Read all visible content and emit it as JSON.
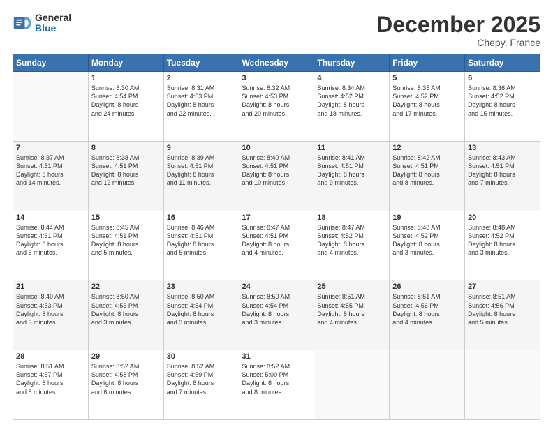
{
  "header": {
    "logo_line1": "General",
    "logo_line2": "Blue",
    "month": "December 2025",
    "location": "Chepy, France"
  },
  "days_of_week": [
    "Sunday",
    "Monday",
    "Tuesday",
    "Wednesday",
    "Thursday",
    "Friday",
    "Saturday"
  ],
  "weeks": [
    [
      {
        "day": "",
        "info": ""
      },
      {
        "day": "1",
        "info": "Sunrise: 8:30 AM\nSunset: 4:54 PM\nDaylight: 8 hours\nand 24 minutes."
      },
      {
        "day": "2",
        "info": "Sunrise: 8:31 AM\nSunset: 4:53 PM\nDaylight: 8 hours\nand 22 minutes."
      },
      {
        "day": "3",
        "info": "Sunrise: 8:32 AM\nSunset: 4:53 PM\nDaylight: 8 hours\nand 20 minutes."
      },
      {
        "day": "4",
        "info": "Sunrise: 8:34 AM\nSunset: 4:52 PM\nDaylight: 8 hours\nand 18 minutes."
      },
      {
        "day": "5",
        "info": "Sunrise: 8:35 AM\nSunset: 4:52 PM\nDaylight: 8 hours\nand 17 minutes."
      },
      {
        "day": "6",
        "info": "Sunrise: 8:36 AM\nSunset: 4:52 PM\nDaylight: 8 hours\nand 15 minutes."
      }
    ],
    [
      {
        "day": "7",
        "info": "Sunrise: 8:37 AM\nSunset: 4:51 PM\nDaylight: 8 hours\nand 14 minutes."
      },
      {
        "day": "8",
        "info": "Sunrise: 8:38 AM\nSunset: 4:51 PM\nDaylight: 8 hours\nand 12 minutes."
      },
      {
        "day": "9",
        "info": "Sunrise: 8:39 AM\nSunset: 4:51 PM\nDaylight: 8 hours\nand 11 minutes."
      },
      {
        "day": "10",
        "info": "Sunrise: 8:40 AM\nSunset: 4:51 PM\nDaylight: 8 hours\nand 10 minutes."
      },
      {
        "day": "11",
        "info": "Sunrise: 8:41 AM\nSunset: 4:51 PM\nDaylight: 8 hours\nand 9 minutes."
      },
      {
        "day": "12",
        "info": "Sunrise: 8:42 AM\nSunset: 4:51 PM\nDaylight: 8 hours\nand 8 minutes."
      },
      {
        "day": "13",
        "info": "Sunrise: 8:43 AM\nSunset: 4:51 PM\nDaylight: 8 hours\nand 7 minutes."
      }
    ],
    [
      {
        "day": "14",
        "info": "Sunrise: 8:44 AM\nSunset: 4:51 PM\nDaylight: 8 hours\nand 6 minutes."
      },
      {
        "day": "15",
        "info": "Sunrise: 8:45 AM\nSunset: 4:51 PM\nDaylight: 8 hours\nand 5 minutes."
      },
      {
        "day": "16",
        "info": "Sunrise: 8:46 AM\nSunset: 4:51 PM\nDaylight: 8 hours\nand 5 minutes."
      },
      {
        "day": "17",
        "info": "Sunrise: 8:47 AM\nSunset: 4:51 PM\nDaylight: 8 hours\nand 4 minutes."
      },
      {
        "day": "18",
        "info": "Sunrise: 8:47 AM\nSunset: 4:52 PM\nDaylight: 8 hours\nand 4 minutes."
      },
      {
        "day": "19",
        "info": "Sunrise: 8:48 AM\nSunset: 4:52 PM\nDaylight: 8 hours\nand 3 minutes."
      },
      {
        "day": "20",
        "info": "Sunrise: 8:48 AM\nSunset: 4:52 PM\nDaylight: 8 hours\nand 3 minutes."
      }
    ],
    [
      {
        "day": "21",
        "info": "Sunrise: 8:49 AM\nSunset: 4:53 PM\nDaylight: 8 hours\nand 3 minutes."
      },
      {
        "day": "22",
        "info": "Sunrise: 8:50 AM\nSunset: 4:53 PM\nDaylight: 8 hours\nand 3 minutes."
      },
      {
        "day": "23",
        "info": "Sunrise: 8:50 AM\nSunset: 4:54 PM\nDaylight: 8 hours\nand 3 minutes."
      },
      {
        "day": "24",
        "info": "Sunrise: 8:50 AM\nSunset: 4:54 PM\nDaylight: 8 hours\nand 3 minutes."
      },
      {
        "day": "25",
        "info": "Sunrise: 8:51 AM\nSunset: 4:55 PM\nDaylight: 8 hours\nand 4 minutes."
      },
      {
        "day": "26",
        "info": "Sunrise: 8:51 AM\nSunset: 4:56 PM\nDaylight: 8 hours\nand 4 minutes."
      },
      {
        "day": "27",
        "info": "Sunrise: 8:51 AM\nSunset: 4:56 PM\nDaylight: 8 hours\nand 5 minutes."
      }
    ],
    [
      {
        "day": "28",
        "info": "Sunrise: 8:51 AM\nSunset: 4:57 PM\nDaylight: 8 hours\nand 5 minutes."
      },
      {
        "day": "29",
        "info": "Sunrise: 8:52 AM\nSunset: 4:58 PM\nDaylight: 8 hours\nand 6 minutes."
      },
      {
        "day": "30",
        "info": "Sunrise: 8:52 AM\nSunset: 4:59 PM\nDaylight: 8 hours\nand 7 minutes."
      },
      {
        "day": "31",
        "info": "Sunrise: 8:52 AM\nSunset: 5:00 PM\nDaylight: 8 hours\nand 8 minutes."
      },
      {
        "day": "",
        "info": ""
      },
      {
        "day": "",
        "info": ""
      },
      {
        "day": "",
        "info": ""
      }
    ]
  ]
}
